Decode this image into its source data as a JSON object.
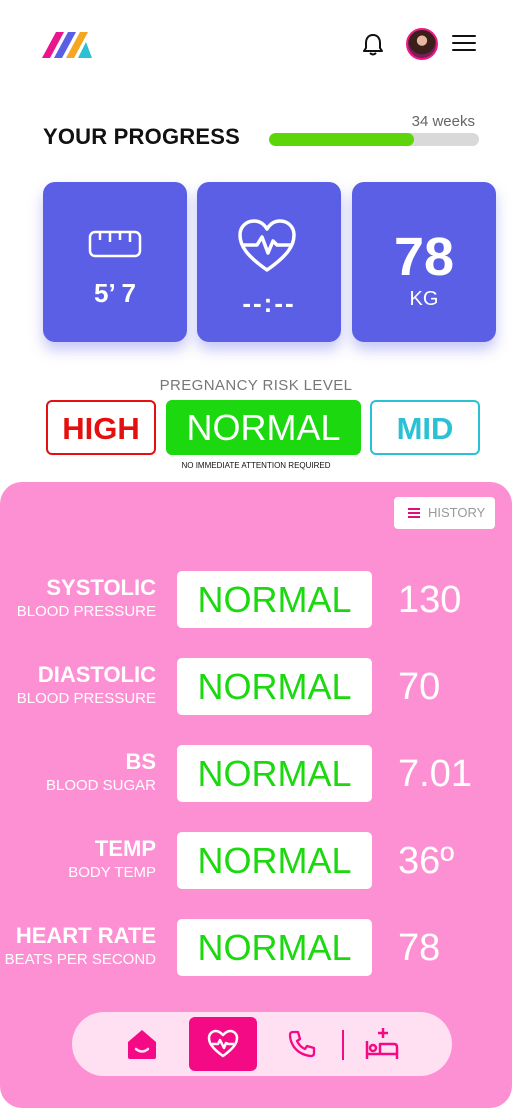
{
  "header": {
    "logo_icon": "brand-logo-icon",
    "notifications_icon": "bell-icon",
    "avatar_icon": "user-avatar",
    "menu_icon": "hamburger-menu-icon"
  },
  "progress": {
    "title": "YOUR PROGRESS",
    "weeks_label": "34 weeks",
    "fill_fraction": 0.69,
    "fill_color": "#5ed40a"
  },
  "stats": {
    "height": {
      "icon": "ruler-icon",
      "value": "5’ 7"
    },
    "heartbeat": {
      "icon": "heartbeat-icon",
      "value": "--:--"
    },
    "weight": {
      "value": "78",
      "unit": "KG"
    }
  },
  "risk": {
    "label": "PREGNANCY RISK LEVEL",
    "high": "HIGH",
    "normal": "NORMAL",
    "mid": "MID",
    "note": "NO IMMEDIATE ATTENTION REQUIRED",
    "colors": {
      "high": "#e40f0f",
      "normal": "#1bd90e",
      "mid": "#2bc1d4"
    }
  },
  "history_button": {
    "label": "HISTORY"
  },
  "vitals": [
    {
      "name": "SYSTOLIC",
      "sub": "BLOOD PRESSURE",
      "status": "NORMAL",
      "value": "130"
    },
    {
      "name": "DIASTOLIC",
      "sub": "BLOOD PRESSURE",
      "status": "NORMAL",
      "value": "70"
    },
    {
      "name": "BS",
      "sub": "BLOOD SUGAR",
      "status": "NORMAL",
      "value": "7.01"
    },
    {
      "name": "TEMP",
      "sub": "BODY TEMP",
      "status": "NORMAL",
      "value": "36º"
    },
    {
      "name": "HEART RATE",
      "sub": "BEATS PER SECOND",
      "status": "NORMAL",
      "value": "78"
    }
  ],
  "nav": {
    "items": [
      "home-icon",
      "heart-monitor-icon",
      "phone-icon",
      "hospital-bed-icon"
    ],
    "active_color": "#f50a86",
    "panel_color": "#fd90d3"
  }
}
